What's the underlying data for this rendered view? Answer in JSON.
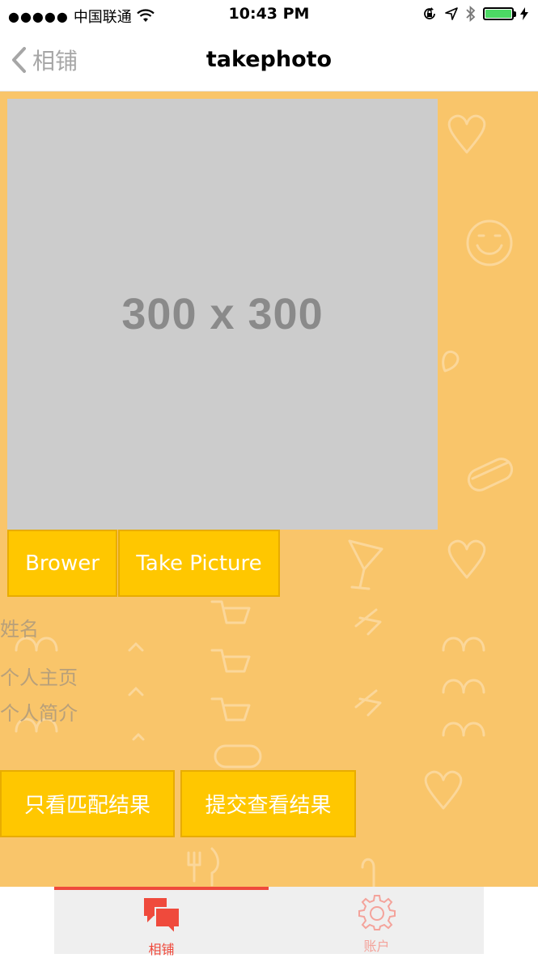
{
  "status_bar": {
    "signal": "●●●●●",
    "carrier": "中国联通",
    "time": "10:43 PM"
  },
  "nav": {
    "back_label": "相铺",
    "title": "takephoto"
  },
  "photo": {
    "placeholder_text": "300 x 300"
  },
  "buttons": {
    "browse": "Brower",
    "take_picture": "Take Picture",
    "match_only": "只看匹配结果",
    "submit_view": "提交查看结果"
  },
  "fields": {
    "name": "姓名",
    "homepage": "个人主页",
    "bio": "个人简介"
  },
  "tabs": [
    {
      "label": "相铺",
      "icon": "chat-bubbles-icon",
      "active": true
    },
    {
      "label": "账户",
      "icon": "gear-icon",
      "active": false
    }
  ],
  "colors": {
    "background": "#f9c56a",
    "button": "#ffc700",
    "tab_active": "#ef4a3c",
    "tab_inactive": "#f4a39b",
    "battery": "#4cd964"
  }
}
